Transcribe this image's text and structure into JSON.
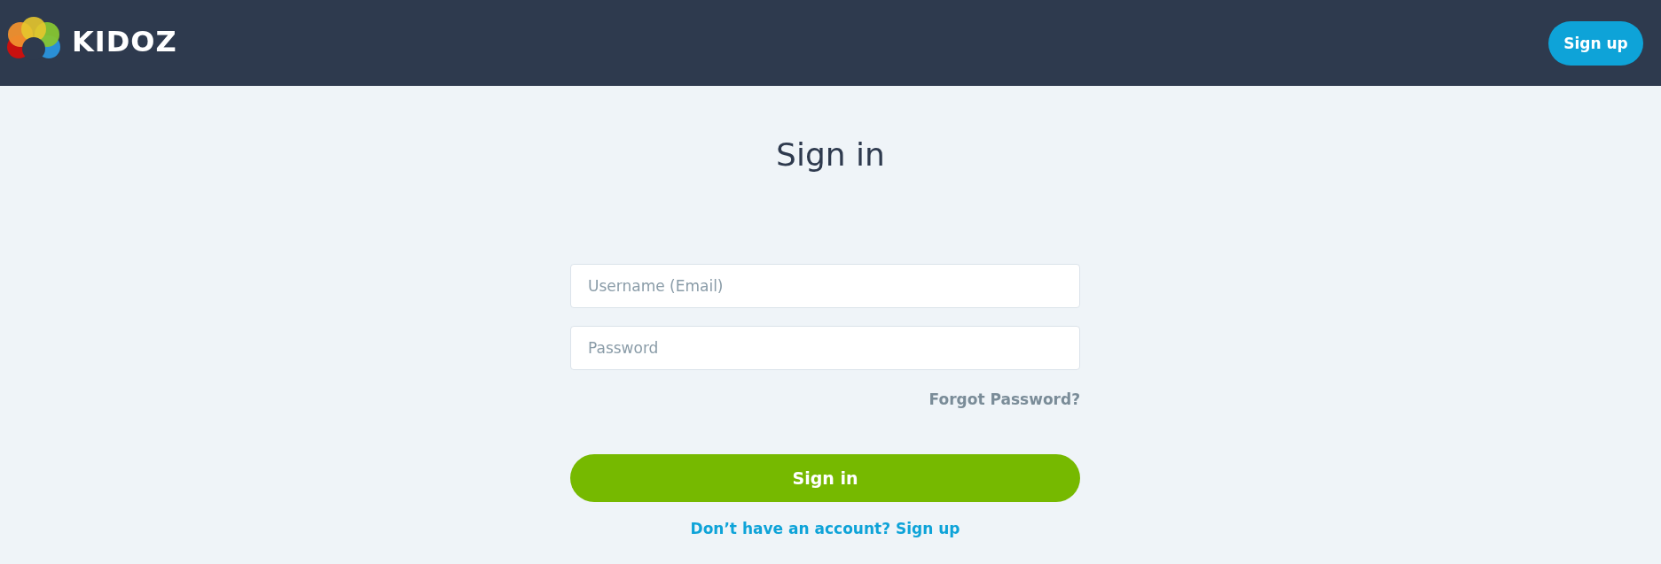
{
  "header": {
    "logo_text": "KIDOZ",
    "signup_button": "Sign up"
  },
  "form": {
    "title": "Sign in",
    "fields": [
      {
        "placeholder": "Username (Email)"
      },
      {
        "placeholder": "Password"
      }
    ],
    "forgot_link": "Forgot Password?",
    "submit_button": "Sign in",
    "signup_link": "Don’t have an account? Sign up"
  }
}
